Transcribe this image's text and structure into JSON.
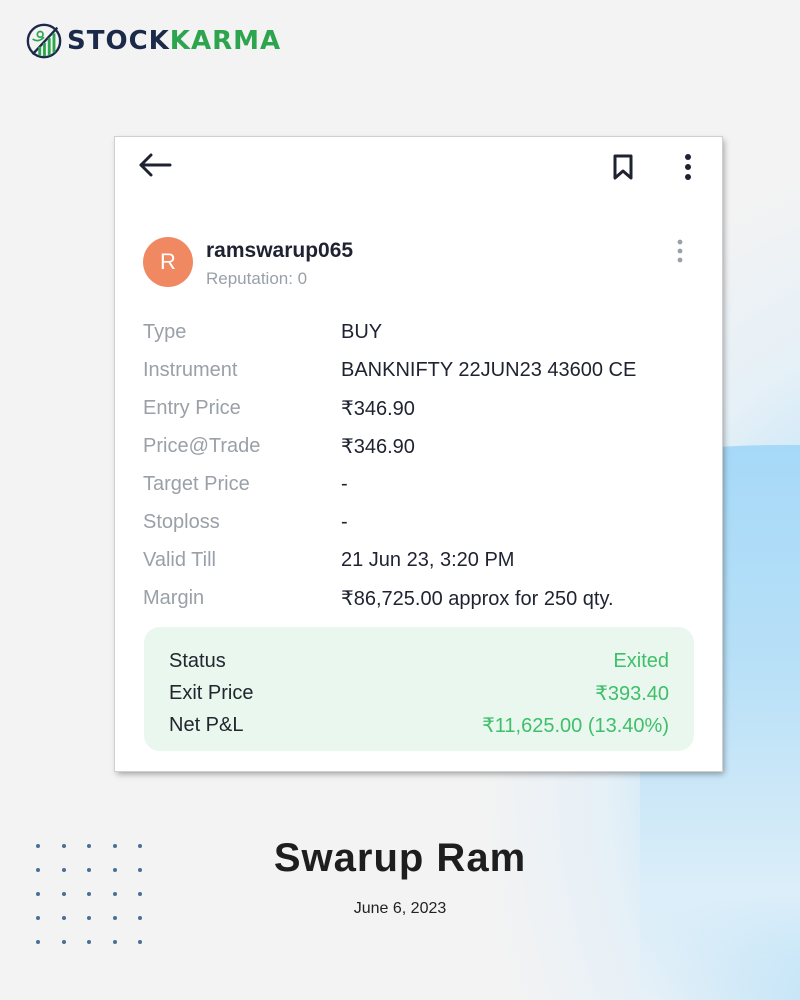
{
  "brand": {
    "name_part1": "STOCK",
    "name_part2": "KARMA",
    "colors": {
      "primary": "#1c2a4a",
      "accent": "#2da44e"
    }
  },
  "card": {
    "toolbar": {
      "back_icon": "arrow-left-icon",
      "bookmark_icon": "bookmark-icon",
      "more_icon": "more-vertical-icon"
    },
    "user": {
      "avatar_initial": "R",
      "avatar_color": "#f08862",
      "username": "ramswarup065",
      "reputation": "Reputation: 0"
    },
    "details": [
      {
        "label": "Type",
        "value": "BUY"
      },
      {
        "label": "Instrument",
        "value": "BANKNIFTY 22JUN23 43600 CE"
      },
      {
        "label": "Entry Price",
        "value": "₹346.90"
      },
      {
        "label": "Price@Trade",
        "value": "₹346.90"
      },
      {
        "label": "Target Price",
        "value": "-"
      },
      {
        "label": "Stoploss",
        "value": "-"
      },
      {
        "label": "Valid Till",
        "value": "21 Jun 23, 3:20 PM"
      },
      {
        "label": "Margin",
        "value": "₹86,725.00 approx for 250 qty."
      }
    ],
    "result": [
      {
        "label": "Status",
        "value": "Exited"
      },
      {
        "label": "Exit Price",
        "value": "₹393.40"
      },
      {
        "label": "Net P&L",
        "value": "₹11,625.00 (13.40%)"
      }
    ],
    "result_color": "#3fbf6a"
  },
  "footer": {
    "name": "Swarup Ram",
    "date": "June 6, 2023"
  }
}
